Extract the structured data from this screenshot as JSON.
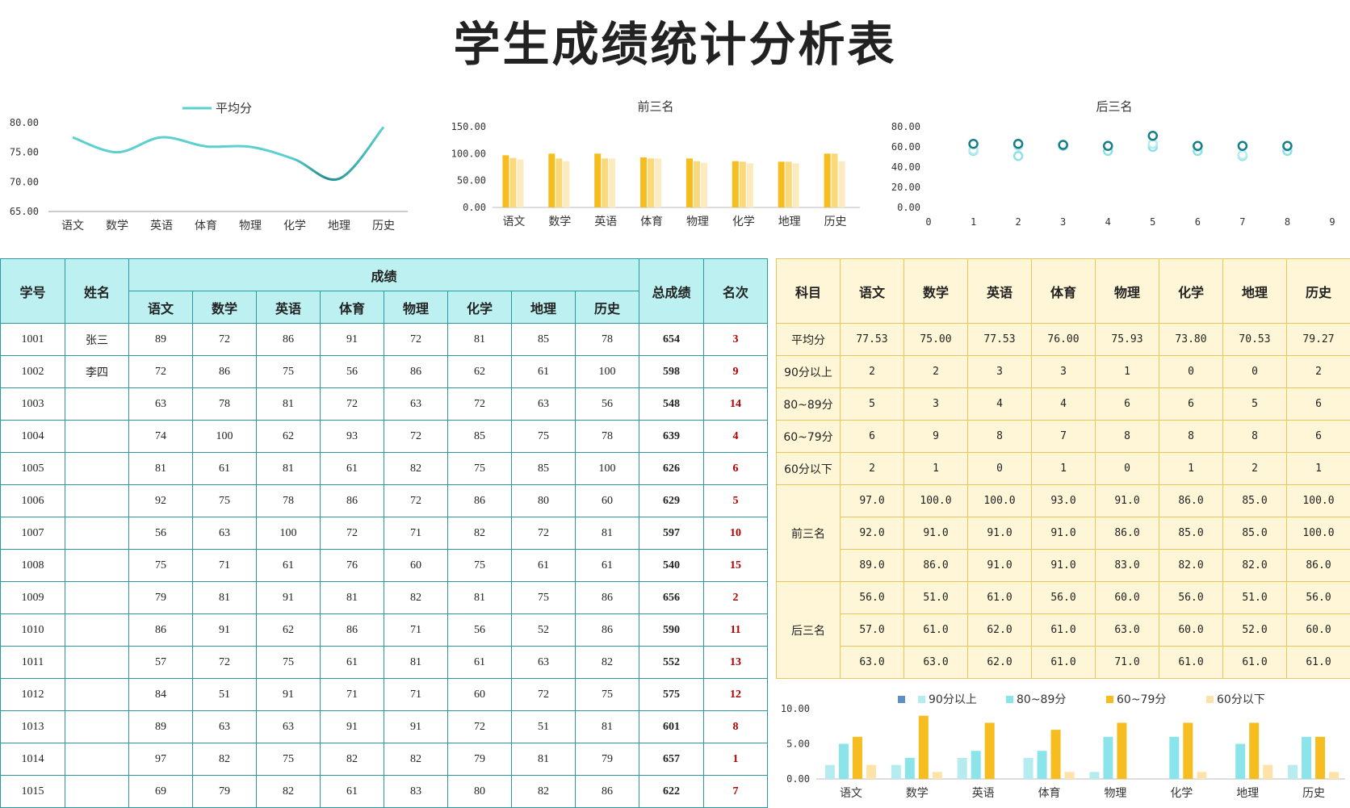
{
  "title": "学生成绩统计分析表",
  "subjects": [
    "语文",
    "数学",
    "英语",
    "体育",
    "物理",
    "化学",
    "地理",
    "历史"
  ],
  "score_table": {
    "headers": {
      "id": "学号",
      "name": "姓名",
      "scores": "成绩",
      "total": "总成绩",
      "rank": "名次"
    },
    "rows": [
      {
        "id": "1001",
        "name": "张三",
        "scores": [
          89,
          72,
          86,
          91,
          72,
          81,
          85,
          78
        ],
        "total": 654,
        "rank": 3
      },
      {
        "id": "1002",
        "name": "李四",
        "scores": [
          72,
          86,
          75,
          56,
          86,
          62,
          61,
          100
        ],
        "total": 598,
        "rank": 9
      },
      {
        "id": "1003",
        "name": "",
        "scores": [
          63,
          78,
          81,
          72,
          63,
          72,
          63,
          56
        ],
        "total": 548,
        "rank": 14
      },
      {
        "id": "1004",
        "name": "",
        "scores": [
          74,
          100,
          62,
          93,
          72,
          85,
          75,
          78
        ],
        "total": 639,
        "rank": 4
      },
      {
        "id": "1005",
        "name": "",
        "scores": [
          81,
          61,
          81,
          61,
          82,
          75,
          85,
          100
        ],
        "total": 626,
        "rank": 6
      },
      {
        "id": "1006",
        "name": "",
        "scores": [
          92,
          75,
          78,
          86,
          72,
          86,
          80,
          60
        ],
        "total": 629,
        "rank": 5
      },
      {
        "id": "1007",
        "name": "",
        "scores": [
          56,
          63,
          100,
          72,
          71,
          82,
          72,
          81
        ],
        "total": 597,
        "rank": 10
      },
      {
        "id": "1008",
        "name": "",
        "scores": [
          75,
          71,
          61,
          76,
          60,
          75,
          61,
          61
        ],
        "total": 540,
        "rank": 15
      },
      {
        "id": "1009",
        "name": "",
        "scores": [
          79,
          81,
          91,
          81,
          82,
          81,
          75,
          86
        ],
        "total": 656,
        "rank": 2
      },
      {
        "id": "1010",
        "name": "",
        "scores": [
          86,
          91,
          62,
          86,
          71,
          56,
          52,
          86
        ],
        "total": 590,
        "rank": 11
      },
      {
        "id": "1011",
        "name": "",
        "scores": [
          57,
          72,
          75,
          61,
          81,
          61,
          63,
          82
        ],
        "total": 552,
        "rank": 13
      },
      {
        "id": "1012",
        "name": "",
        "scores": [
          84,
          51,
          91,
          71,
          71,
          60,
          72,
          75
        ],
        "total": 575,
        "rank": 12
      },
      {
        "id": "1013",
        "name": "",
        "scores": [
          89,
          63,
          63,
          91,
          91,
          72,
          51,
          81
        ],
        "total": 601,
        "rank": 8
      },
      {
        "id": "1014",
        "name": "",
        "scores": [
          97,
          82,
          75,
          82,
          82,
          79,
          81,
          79
        ],
        "total": 657,
        "rank": 1
      },
      {
        "id": "1015",
        "name": "",
        "scores": [
          69,
          79,
          82,
          61,
          83,
          80,
          82,
          86
        ],
        "total": 622,
        "rank": 7
      }
    ]
  },
  "stats_table": {
    "header": "科目",
    "average_label": "平均分",
    "averages": [
      "77.53",
      "75.00",
      "77.53",
      "76.00",
      "75.93",
      "73.80",
      "70.53",
      "79.27"
    ],
    "bands": [
      {
        "label": "90分以上",
        "values": [
          2,
          2,
          3,
          3,
          1,
          0,
          0,
          2
        ]
      },
      {
        "label": "80~89分",
        "values": [
          5,
          3,
          4,
          4,
          6,
          6,
          5,
          6
        ]
      },
      {
        "label": "60~79分",
        "values": [
          6,
          9,
          8,
          7,
          8,
          8,
          8,
          6
        ]
      },
      {
        "label": "60分以下",
        "values": [
          2,
          1,
          0,
          1,
          0,
          1,
          2,
          1
        ]
      }
    ],
    "top3_label": "前三名",
    "top3": [
      [
        "97.0",
        "100.0",
        "100.0",
        "93.0",
        "91.0",
        "86.0",
        "85.0",
        "100.0"
      ],
      [
        "92.0",
        "91.0",
        "91.0",
        "91.0",
        "86.0",
        "85.0",
        "85.0",
        "100.0"
      ],
      [
        "89.0",
        "86.0",
        "91.0",
        "91.0",
        "83.0",
        "82.0",
        "82.0",
        "86.0"
      ]
    ],
    "bottom3_label": "后三名",
    "bottom3": [
      [
        "56.0",
        "51.0",
        "61.0",
        "56.0",
        "60.0",
        "56.0",
        "51.0",
        "56.0"
      ],
      [
        "57.0",
        "61.0",
        "62.0",
        "61.0",
        "63.0",
        "60.0",
        "52.0",
        "60.0"
      ],
      [
        "63.0",
        "63.0",
        "62.0",
        "61.0",
        "71.0",
        "61.0",
        "61.0",
        "61.0"
      ]
    ]
  },
  "chart_data": [
    {
      "type": "line",
      "legend": "平均分",
      "categories": [
        "语文",
        "数学",
        "英语",
        "体育",
        "物理",
        "化学",
        "地理",
        "历史"
      ],
      "values": [
        77.53,
        75.0,
        77.53,
        76.0,
        75.93,
        73.8,
        70.53,
        79.27
      ],
      "ylim": [
        65,
        80
      ],
      "yticks": [
        "65.00",
        "70.00",
        "75.00",
        "80.00"
      ],
      "color": "#5ccfd0",
      "color_dark": "#1f8c91"
    },
    {
      "type": "bar",
      "title": "前三名",
      "categories": [
        "语文",
        "数学",
        "英语",
        "体育",
        "物理",
        "化学",
        "地理",
        "历史"
      ],
      "series": [
        {
          "values": [
            97,
            100,
            100,
            93,
            91,
            86,
            85,
            100
          ],
          "color": "#f5bd1f"
        },
        {
          "values": [
            92,
            91,
            91,
            91,
            86,
            85,
            85,
            100
          ],
          "color": "#f9d97a"
        },
        {
          "values": [
            89,
            86,
            91,
            91,
            83,
            82,
            82,
            86
          ],
          "color": "#fcebc0"
        }
      ],
      "ylim": [
        0,
        150
      ],
      "yticks": [
        "0.00",
        "50.00",
        "100.00",
        "150.00"
      ]
    },
    {
      "type": "scatter",
      "title": "后三名",
      "x": [
        1,
        2,
        3,
        4,
        5,
        6,
        7,
        8
      ],
      "series": [
        {
          "values": [
            56,
            51,
            61,
            56,
            60,
            56,
            51,
            56
          ],
          "color": "#8fe0e6"
        },
        {
          "values": [
            57,
            61,
            62,
            61,
            63,
            60,
            52,
            60
          ],
          "color": "#b6ecef"
        },
        {
          "values": [
            63,
            63,
            62,
            61,
            71,
            61,
            61,
            61
          ],
          "color": "#157f86"
        }
      ],
      "xlim": [
        0,
        9
      ],
      "xticks": [
        "0",
        "1",
        "2",
        "3",
        "4",
        "5",
        "6",
        "7",
        "8",
        "9"
      ],
      "ylim": [
        0,
        80
      ],
      "yticks": [
        "0.00",
        "20.00",
        "40.00",
        "60.00",
        "80.00"
      ]
    },
    {
      "type": "bar",
      "categories": [
        "语文",
        "数学",
        "英语",
        "体育",
        "物理",
        "化学",
        "地理",
        "历史"
      ],
      "series": [
        {
          "name": "90分以上",
          "values": [
            2,
            2,
            3,
            3,
            1,
            0,
            0,
            2
          ],
          "color": "#b6ecef"
        },
        {
          "name": "80~89分",
          "values": [
            5,
            3,
            4,
            4,
            6,
            6,
            5,
            6
          ],
          "color": "#8ae4ea"
        },
        {
          "name": "60~79分",
          "values": [
            6,
            9,
            8,
            7,
            8,
            8,
            8,
            6
          ],
          "color": "#f5bd1f"
        },
        {
          "name": "60分以下",
          "values": [
            2,
            1,
            0,
            1,
            0,
            1,
            2,
            1
          ],
          "color": "#fde3a8"
        }
      ],
      "legend_marker_color": "#5b8fc5",
      "ylim": [
        0,
        10
      ],
      "yticks": [
        "0.00",
        "5.00",
        "10.00"
      ]
    }
  ]
}
